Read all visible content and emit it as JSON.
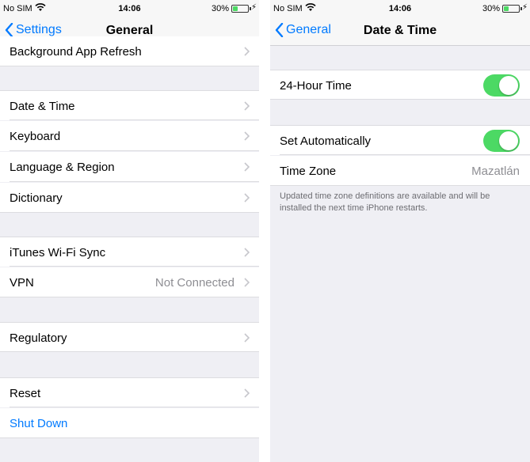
{
  "status": {
    "carrier": "No SIM",
    "time": "14:06",
    "battery": "30%"
  },
  "left": {
    "back_label": "Settings",
    "title": "General",
    "rows": {
      "background_refresh": "Background App Refresh",
      "date_time": "Date & Time",
      "keyboard": "Keyboard",
      "language_region": "Language & Region",
      "dictionary": "Dictionary",
      "itunes_sync": "iTunes Wi-Fi Sync",
      "vpn": "VPN",
      "vpn_value": "Not Connected",
      "regulatory": "Regulatory",
      "reset": "Reset",
      "shut_down": "Shut Down"
    }
  },
  "right": {
    "back_label": "General",
    "title": "Date & Time",
    "hour24": {
      "label": "24-Hour Time",
      "on": true
    },
    "set_auto": {
      "label": "Set Automatically",
      "on": true
    },
    "time_zone": {
      "label": "Time Zone",
      "value": "Mazatlán"
    },
    "footnote": "Updated time zone definitions are available and will be installed the next time iPhone restarts."
  },
  "colors": {
    "accent": "#007aff",
    "toggle_on": "#4cd964",
    "group_bg": "#efeff4"
  }
}
